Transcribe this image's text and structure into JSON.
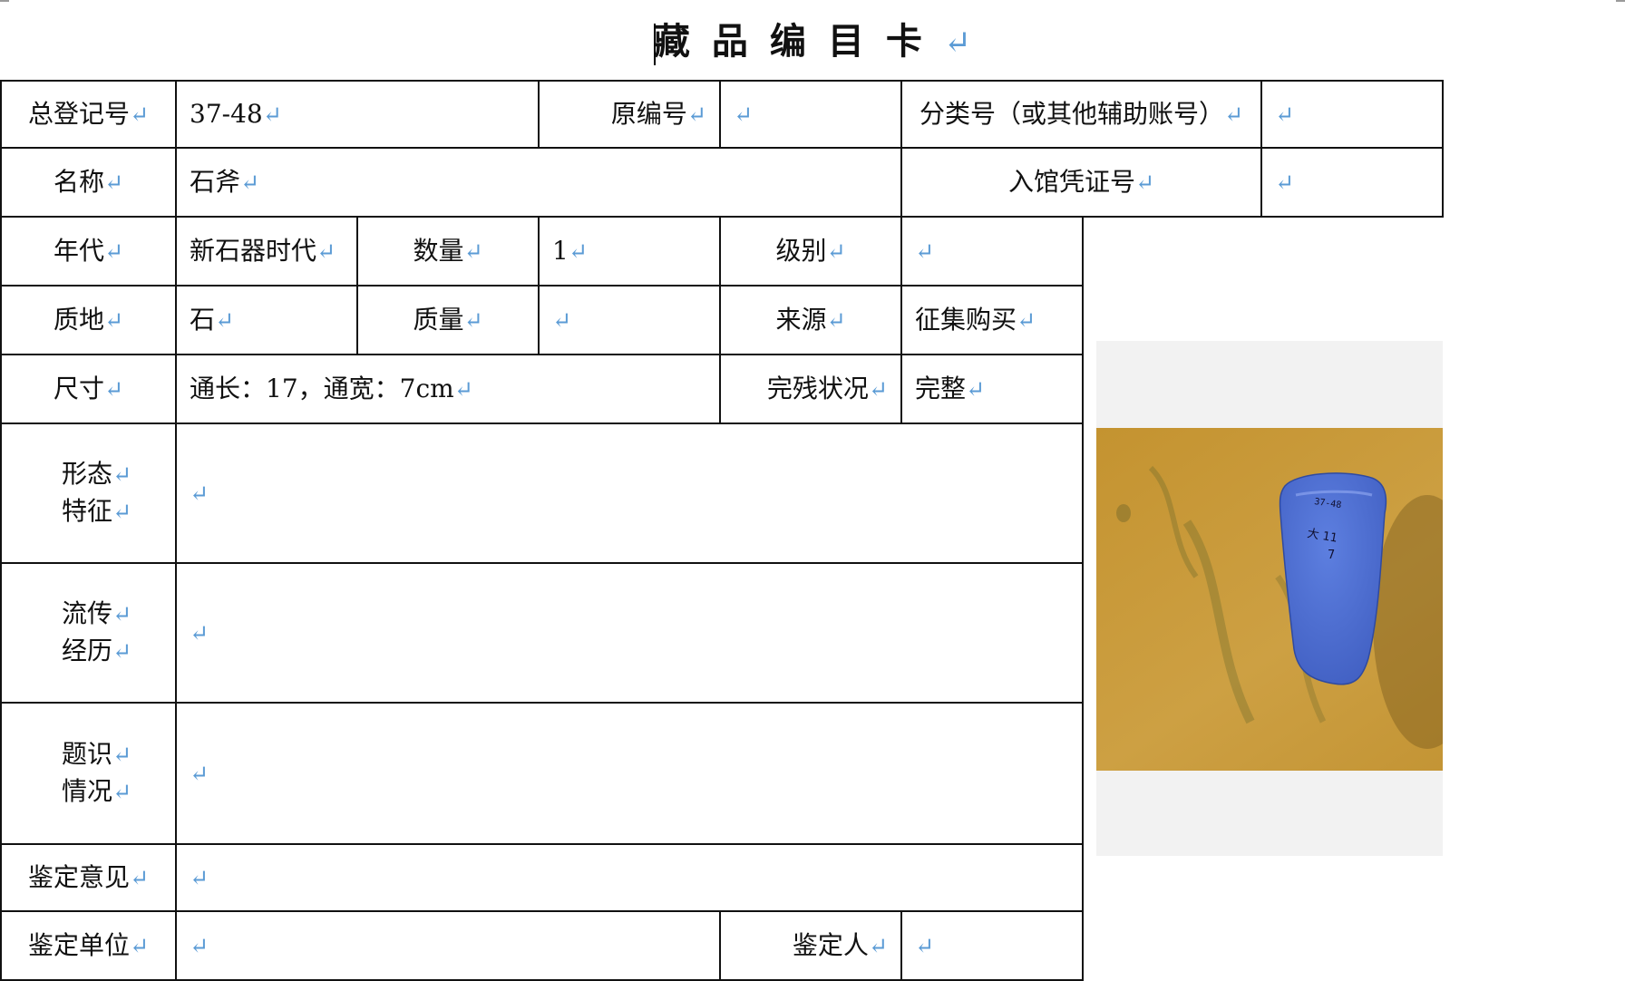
{
  "title": "藏品编目卡",
  "para_mark": "↵",
  "rows": {
    "r1": {
      "total_reg_label": "总登记号",
      "total_reg_value": "37-48",
      "orig_no_label": "原编号",
      "orig_no_value": "",
      "class_no_label": "分类号（或其他辅助账号）",
      "class_no_value": ""
    },
    "r2": {
      "name_label": "名称",
      "name_value": "石斧",
      "entry_voucher_label": "入馆凭证号",
      "entry_voucher_value": ""
    },
    "r3": {
      "era_label": "年代",
      "era_value": "新石器时代",
      "qty_label": "数量",
      "qty_value": "1",
      "grade_label": "级别",
      "grade_value": ""
    },
    "r4": {
      "material_label": "质地",
      "material_value": "石",
      "mass_label": "质量",
      "mass_value": "",
      "source_label": "来源",
      "source_value": "征集购买"
    },
    "r5": {
      "size_label": "尺寸",
      "size_value": "通长：17，通宽：7cm",
      "condition_label": "完残状况",
      "condition_value": "完整"
    },
    "r6": {
      "label_line1": "形态",
      "label_line2": "特征",
      "value": ""
    },
    "r7": {
      "label_line1": "流传",
      "label_line2": "经历",
      "value": ""
    },
    "r8": {
      "label_line1": "题识",
      "label_line2": "情况",
      "value": ""
    },
    "r9": {
      "label": "鉴定意见",
      "value": ""
    },
    "r10": {
      "unit_label": "鉴定单位",
      "unit_value": "",
      "person_label": "鉴定人",
      "person_value": ""
    }
  },
  "photo": {
    "subject": "blue stone axe on yellow cloth",
    "ink_text_1": "37-48",
    "ink_text_2": "大 11",
    "ink_text_3": "7",
    "colors": {
      "cloth": "#c79a36",
      "axe": "#4d6fd0",
      "frame": "#f2f2f2"
    }
  }
}
